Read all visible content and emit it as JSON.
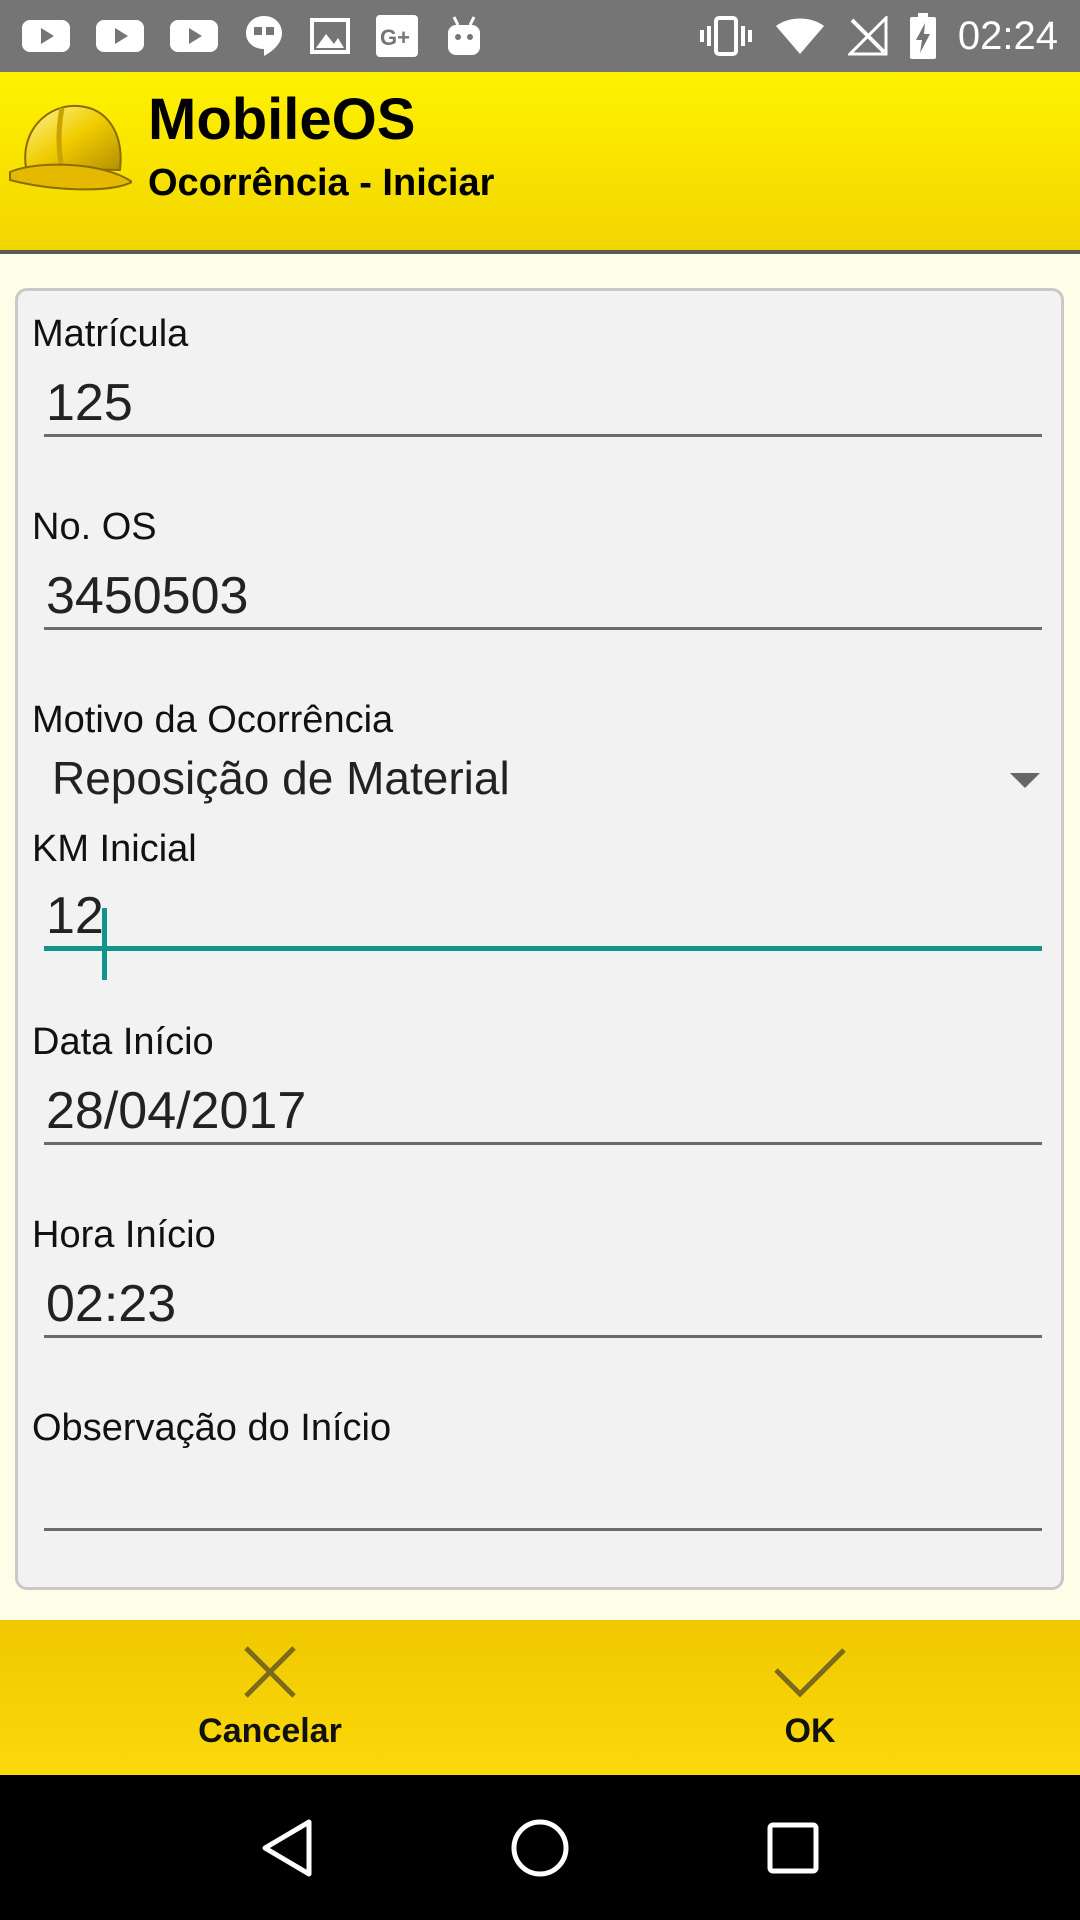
{
  "status_bar": {
    "time": "02:24",
    "notification_icons": [
      "youtube-icon",
      "youtube-icon",
      "youtube-icon",
      "hangouts-icon",
      "image-icon",
      "google-plus-icon",
      "android-icon"
    ],
    "system_icons": [
      "vibrate-icon",
      "wifi-icon",
      "no-signal-icon",
      "battery-charging-icon"
    ]
  },
  "app_bar": {
    "title": "MobileOS",
    "subtitle": "Ocorrência - Iniciar",
    "logo_icon": "hard-hat-icon"
  },
  "form": {
    "matricula": {
      "label": "Matrícula",
      "value": "125"
    },
    "numero_os": {
      "label": "No. OS",
      "value": "3450503"
    },
    "motivo": {
      "label": "Motivo da Ocorrência",
      "selected": "Reposição de Material"
    },
    "km_inicial": {
      "label": "KM Inicial",
      "value": "12"
    },
    "data_inicio": {
      "label": "Data Início",
      "value": "28/04/2017"
    },
    "hora_inicio": {
      "label": "Hora Início",
      "value": "02:23"
    },
    "observacao": {
      "label": "Observação do Início",
      "value": ""
    }
  },
  "actions": {
    "cancel_label": "Cancelar",
    "ok_label": "OK"
  },
  "colors": {
    "app_bar": "#fff200",
    "action_bar": "#f6cf00",
    "accent": "#11958b",
    "status_bar": "#757575"
  }
}
